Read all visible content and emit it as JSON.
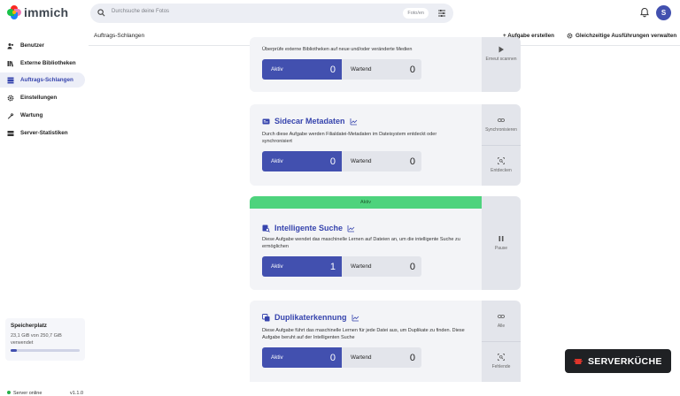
{
  "app": {
    "name": "immich"
  },
  "search": {
    "placeholder": "Durchsuche deine Fotos",
    "filter_label": "Foto/en"
  },
  "user": {
    "initial": "S"
  },
  "sidebar": {
    "items": [
      {
        "label": "Benutzer",
        "icon": "users-icon"
      },
      {
        "label": "Externe Bibliotheken",
        "icon": "library-icon"
      },
      {
        "label": "Auftrags-Schlangen",
        "icon": "queue-icon",
        "active": true
      },
      {
        "label": "Einstellungen",
        "icon": "gear-icon"
      },
      {
        "label": "Wartung",
        "icon": "wrench-icon"
      },
      {
        "label": "Server-Statistiken",
        "icon": "server-icon"
      }
    ],
    "storage": {
      "title": "Speicherplatz",
      "usage": "23,1 GiB von 250,7 GiB verwendet",
      "fraction": 0.092
    },
    "server": {
      "status": "Server online",
      "version": "v1.1.0"
    }
  },
  "subbar": {
    "title": "Auftrags-Schlangen",
    "create_job": "+ Aufgabe erstellen",
    "concurrency": "Gleichzeitige Ausführungen verwalten"
  },
  "cards": [
    {
      "desc": "Überprüfe externe Bibliotheken auf neue und/oder veränderte Medien",
      "active_label": "Aktiv",
      "active_count": "0",
      "waiting_label": "Wartend",
      "waiting_count": "0",
      "action": "Erneut scannen"
    },
    {
      "title": "Sidecar Metadaten",
      "desc": "Durch diese Aufgabe werden Filialdatei-Metadaten im Dateisystem entdeckt oder synchronisiert",
      "active_label": "Aktiv",
      "active_count": "0",
      "waiting_label": "Wartend",
      "waiting_count": "0",
      "action1": "Synchronisieren",
      "action2": "Entdecken"
    },
    {
      "banner": "Aktiv",
      "title": "Intelligente Suche",
      "desc": "Diese Aufgabe wendet das maschinelle Lernen auf Dateien an, um die intelligente Suche zu ermöglichen",
      "active_label": "Aktiv",
      "active_count": "1",
      "waiting_label": "Wartend",
      "waiting_count": "0",
      "action": "Pause"
    },
    {
      "title": "Duplikaterkennung",
      "desc": "Diese Aufgabe führt das maschinelle Lernen für jede Datei aus, um Duplikate zu finden. Diese Aufgabe beruht auf der Intelligenten Suche",
      "active_label": "Aktiv",
      "active_count": "0",
      "waiting_label": "Wartend",
      "waiting_count": "0",
      "action1": "Alle",
      "action2": "Fehlende"
    }
  ],
  "badge": {
    "text": "SERVERKÜCHE"
  },
  "colors": {
    "primary": "#4250af",
    "banner": "#4ed37d",
    "card_bg": "#f3f4f7",
    "side_bg": "#e3e5eb"
  }
}
